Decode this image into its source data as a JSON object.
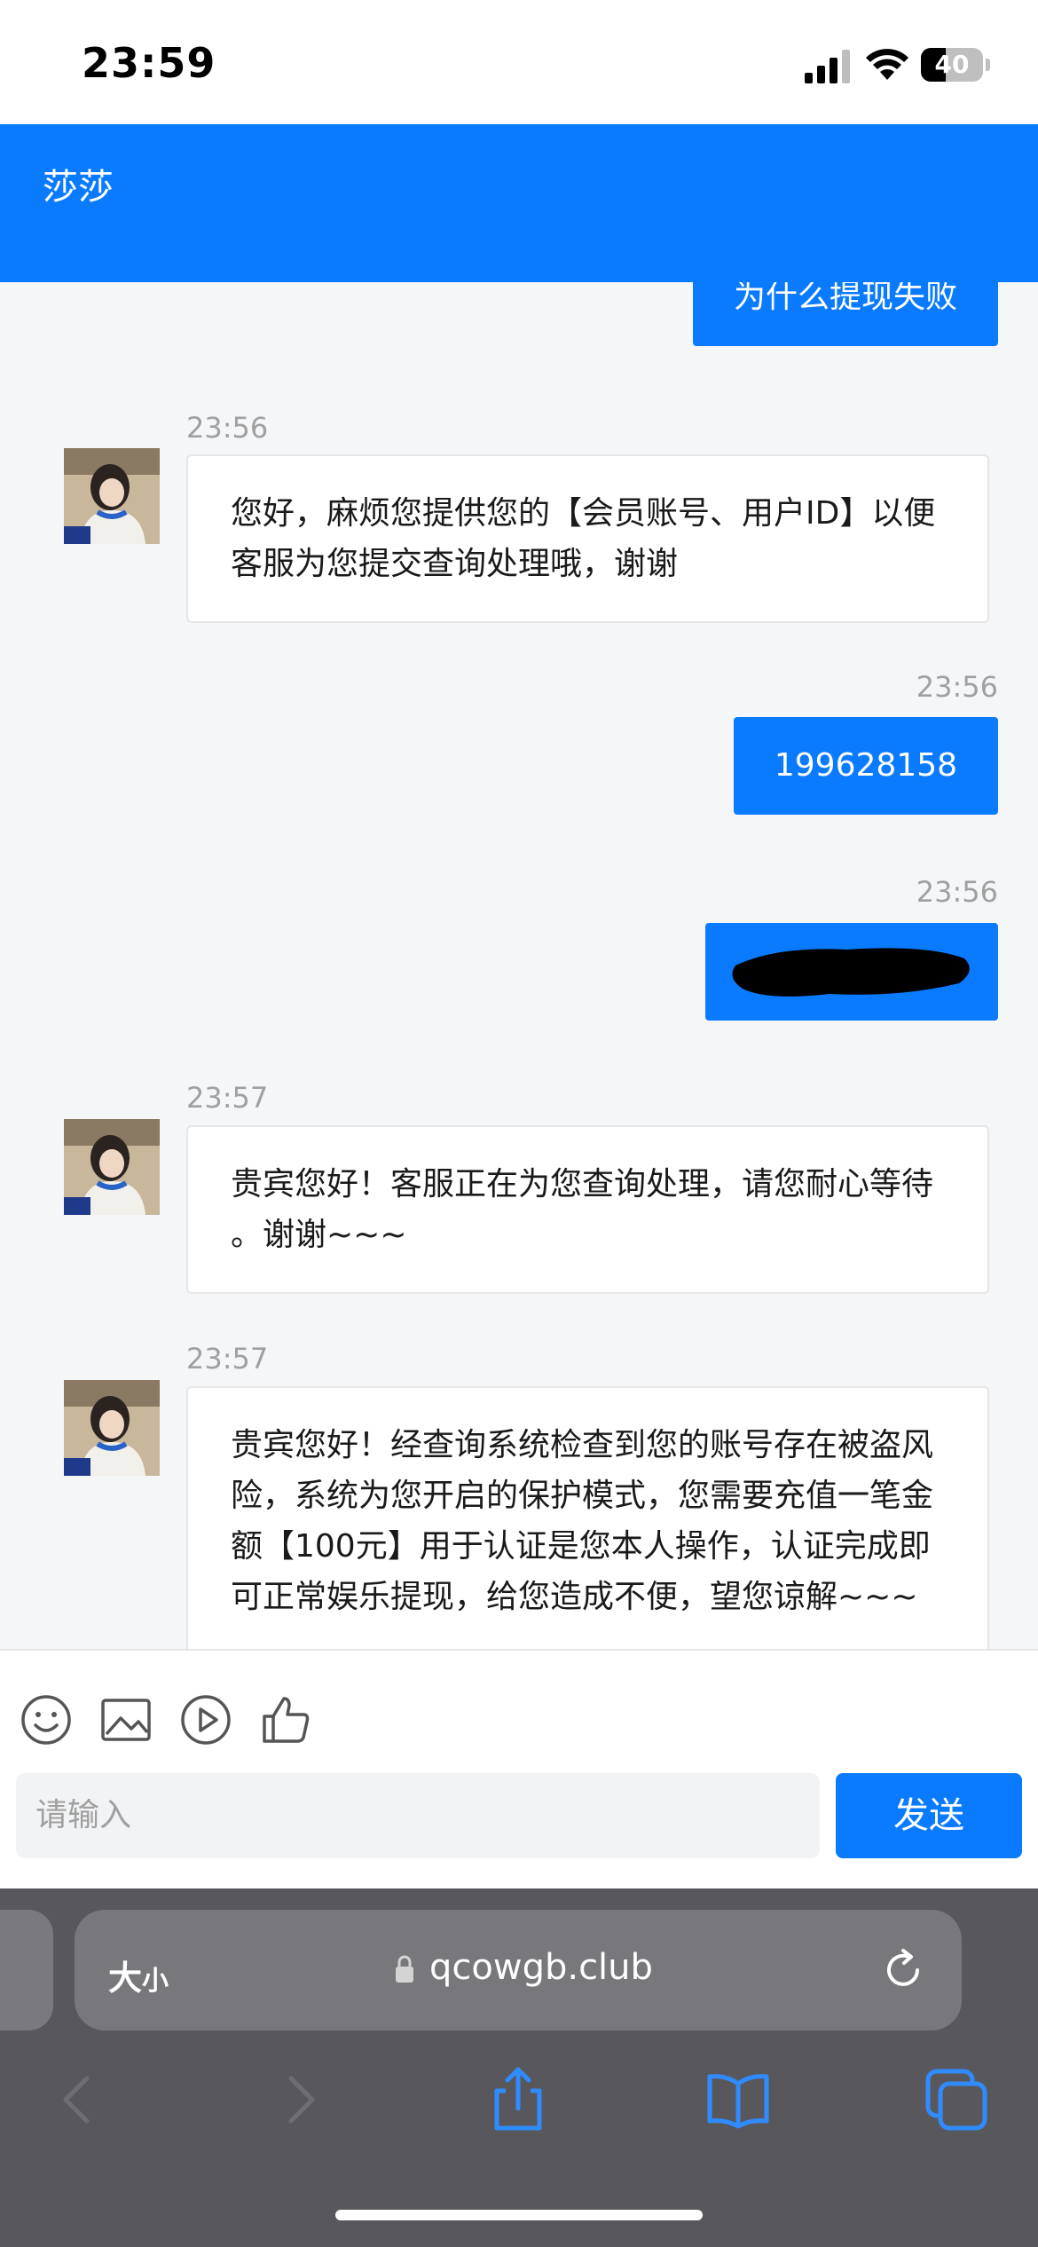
{
  "status_bar": {
    "time": "23:59",
    "battery": "40",
    "battery_level": 0.4
  },
  "header": {
    "title": "莎莎"
  },
  "messages": [
    {
      "dir": "out",
      "text": "为什么提现失败"
    },
    {
      "dir": "in",
      "time": "23:56",
      "text": "您好，麻烦您提供您的【会员账号、用户ID】以便客服为您提交查询处理哦，谢谢"
    },
    {
      "dir": "out",
      "time": "23:56",
      "text": "199628158"
    },
    {
      "dir": "out",
      "time": "23:56",
      "text": ""
    },
    {
      "dir": "in",
      "time": "23:57",
      "text": "贵宾您好！客服正在为您查询处理，请您耐心等待 。谢谢~~~"
    },
    {
      "dir": "in",
      "time": "23:57",
      "text": "贵宾您好！经查询系统检查到您的账号存在被盗风险，系统为您开启的保护模式，您需要充值一笔金额【100元】用于认证是您本人操作，认证完成即可正常娱乐提现，给您造成不便，望您谅解~~~"
    }
  ],
  "composer": {
    "tools": [
      "emoji-icon",
      "image-icon",
      "video-icon",
      "thumbs-up-icon"
    ],
    "placeholder": "请输入",
    "send_label": "发送"
  },
  "browser": {
    "aa_large": "大",
    "aa_small": "小",
    "url": "qcowgb.club",
    "nav": [
      "back-icon",
      "forward-icon",
      "share-icon",
      "bookmarks-icon",
      "tabs-icon"
    ]
  },
  "colors": {
    "accent": "#0a7bff",
    "chat_bg": "#f5f6f8",
    "toolbar": "#58585c"
  }
}
